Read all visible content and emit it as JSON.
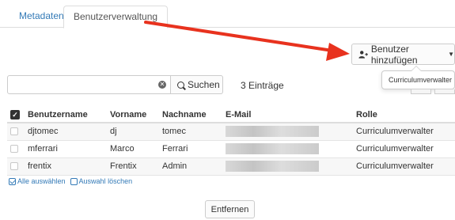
{
  "tabs": [
    {
      "label": "Metadaten"
    },
    {
      "label": "Benutzerverwaltung"
    }
  ],
  "colors": {
    "arrow": "#e8321e",
    "link": "#337ab7"
  },
  "toolbar": {
    "add_user_label": "Benutzer hinzufügen",
    "add_user_icon": "user-plus-icon",
    "caret_icon": "caret-down-icon",
    "popover_item": "Curriculumverwalter"
  },
  "search": {
    "value": "",
    "placeholder": "",
    "button_label": "Suchen",
    "result_count": "3 Einträge"
  },
  "table": {
    "headers": [
      "Benutzername",
      "Vorname",
      "Nachname",
      "E-Mail",
      "Rolle"
    ],
    "rows": [
      {
        "username": "djtomec",
        "first": "dj",
        "last": "tomec",
        "email_hidden": true,
        "role": "Curriculumverwalter"
      },
      {
        "username": "mferrari",
        "first": "Marco",
        "last": "Ferrari",
        "email_hidden": true,
        "role": "Curriculumverwalter"
      },
      {
        "username": "frentix",
        "first": "Frentix",
        "last": "Admin",
        "email_hidden": true,
        "role": "Curriculumverwalter"
      }
    ]
  },
  "selection": {
    "select_all": "Alle auswählen",
    "clear_selection": "Auswahl löschen"
  },
  "actions": {
    "remove_label": "Entfernen"
  }
}
